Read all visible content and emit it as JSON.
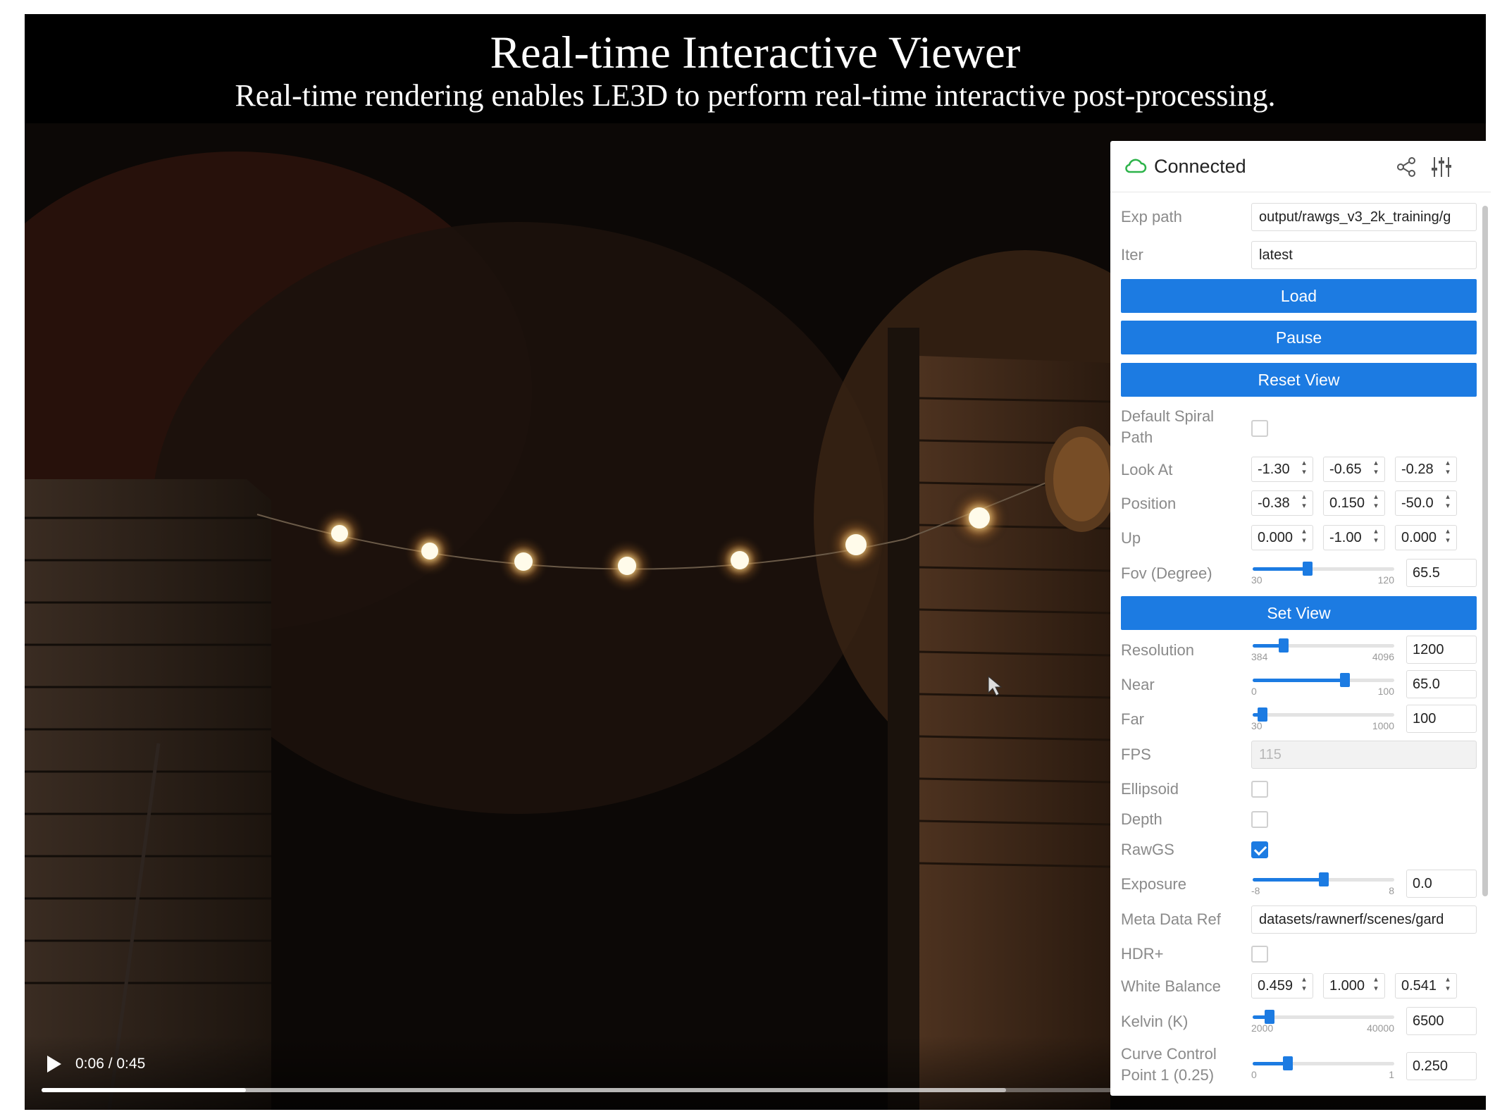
{
  "header": {
    "title": "Real-time Interactive Viewer",
    "subtitle": "Real-time rendering enables LE3D to perform real-time interactive post-processing."
  },
  "panel": {
    "status": "Connected",
    "icons": {
      "status": "cloud-connected-icon",
      "share": "share-icon",
      "settings": "tune-icon"
    },
    "accent_color": "#1c7be2",
    "exp_path": {
      "label": "Exp path",
      "value": "output/rawgs_v3_2k_training/g"
    },
    "iter": {
      "label": "Iter",
      "value": "latest"
    },
    "buttons": {
      "load": "Load",
      "pause": "Pause",
      "reset_view": "Reset View",
      "set_view": "Set View"
    },
    "default_spiral": {
      "label": "Default Spiral Path",
      "checked": false
    },
    "look_at": {
      "label": "Look At",
      "values": [
        "-1.30",
        "-0.65",
        "-0.28"
      ]
    },
    "position": {
      "label": "Position",
      "values": [
        "-0.38",
        "0.150",
        "-50.0"
      ]
    },
    "up": {
      "label": "Up",
      "values": [
        "0.000",
        "-1.00",
        "0.000"
      ]
    },
    "fov": {
      "label": "Fov (Degree)",
      "min": "30",
      "max": "120",
      "value": "65.5",
      "level": 0.39
    },
    "resolution": {
      "label": "Resolution",
      "min": "384",
      "max": "4096",
      "value": "1200",
      "level": 0.22
    },
    "near": {
      "label": "Near",
      "min": "0",
      "max": "100",
      "value": "65.0",
      "level": 0.65
    },
    "far": {
      "label": "Far",
      "min": "30",
      "max": "1000",
      "value": "100",
      "level": 0.07
    },
    "fps": {
      "label": "FPS",
      "value": "115"
    },
    "ellipsoid": {
      "label": "Ellipsoid",
      "checked": false
    },
    "depth": {
      "label": "Depth",
      "checked": false
    },
    "rawgs": {
      "label": "RawGS",
      "checked": true
    },
    "exposure": {
      "label": "Exposure",
      "min": "-8",
      "max": "8",
      "value": "0.0",
      "level": 0.5
    },
    "meta_data_ref": {
      "label": "Meta Data Ref",
      "value": "datasets/rawnerf/scenes/gard"
    },
    "hdr_plus": {
      "label": "HDR+",
      "checked": false
    },
    "white_balance": {
      "label": "White Balance",
      "values": [
        "0.459",
        "1.000",
        "0.541"
      ]
    },
    "kelvin": {
      "label": "Kelvin (K)",
      "min": "2000",
      "max": "40000",
      "value": "6500",
      "level": 0.12
    },
    "curve_control": {
      "label": "Curve Control Point 1 (0.25)",
      "min": "0",
      "max": "1",
      "value": "0.250",
      "level": 0.25
    }
  },
  "video": {
    "time": "0:06 / 0:45",
    "progress": 0.143,
    "buffered": 0.675,
    "icons": {
      "play": "play-icon",
      "mute": "mute-icon",
      "fullscreen": "fullscreen-icon",
      "more": "more-vert-icon"
    }
  }
}
